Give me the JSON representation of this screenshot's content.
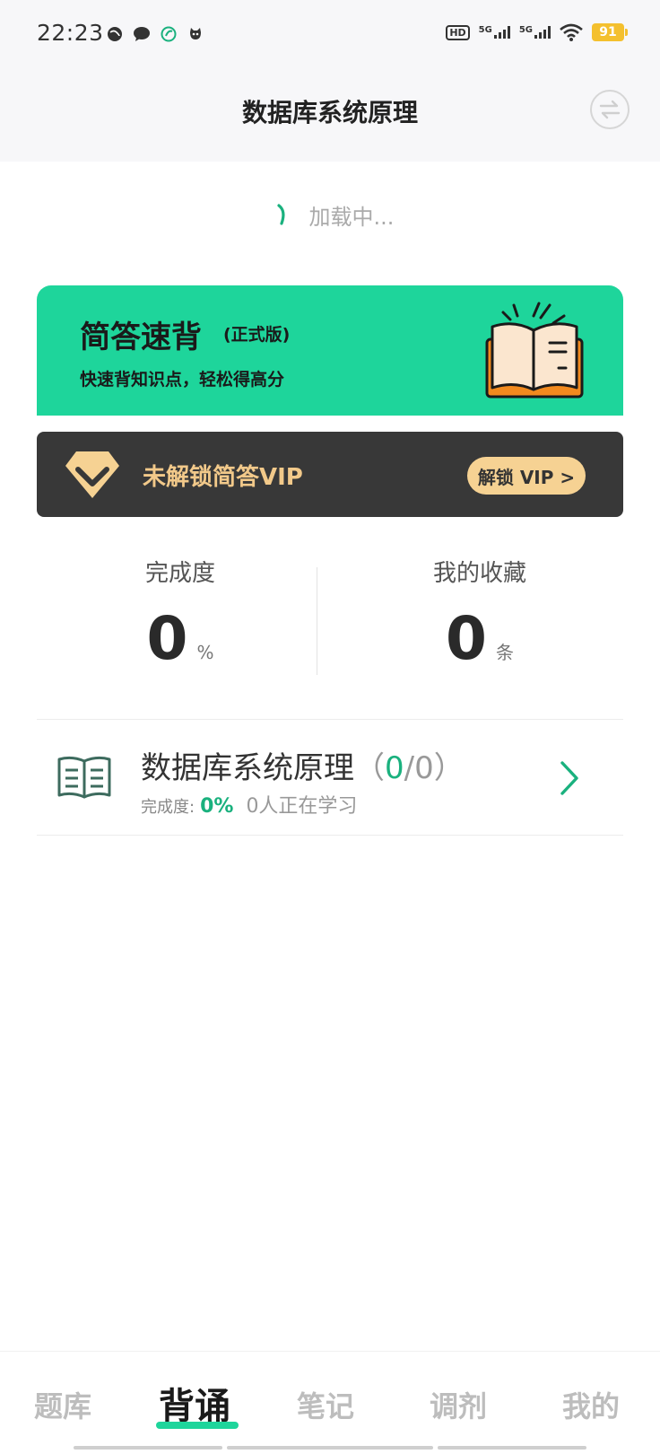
{
  "status": {
    "time": "22:23",
    "left_icons": [
      "globe-icon",
      "chat-icon",
      "leaf-icon",
      "cat-icon"
    ],
    "network_labels": [
      "HD",
      "5G",
      "5G"
    ],
    "battery": "91"
  },
  "header": {
    "title": "数据库系统原理",
    "swap_icon": "swap-icon"
  },
  "loading": {
    "text": "加载中..."
  },
  "promo": {
    "title": "简答速背",
    "badge": "(正式版)",
    "subtitle": "快速背知识点，轻松得高分",
    "accent": "#1ed59b"
  },
  "vip": {
    "text": "未解锁简答VIP",
    "button": "解锁 VIP >",
    "bg": "#383838",
    "gold": "#f6d293"
  },
  "stats": {
    "completion_label": "完成度",
    "completion_value": "0",
    "completion_unit": "%",
    "favorites_label": "我的收藏",
    "favorites_value": "0",
    "favorites_unit": "条"
  },
  "course": {
    "title": "数据库系统原理",
    "count_open": "（",
    "count_done": "0",
    "count_rest": "/0）",
    "progress_label": "完成度:",
    "progress_value": "0%",
    "learners": "0人正在学习"
  },
  "tabs": [
    {
      "label": "题库",
      "active": false
    },
    {
      "label": "背诵",
      "active": true
    },
    {
      "label": "笔记",
      "active": false
    },
    {
      "label": "调剂",
      "active": false
    },
    {
      "label": "我的",
      "active": false
    }
  ]
}
